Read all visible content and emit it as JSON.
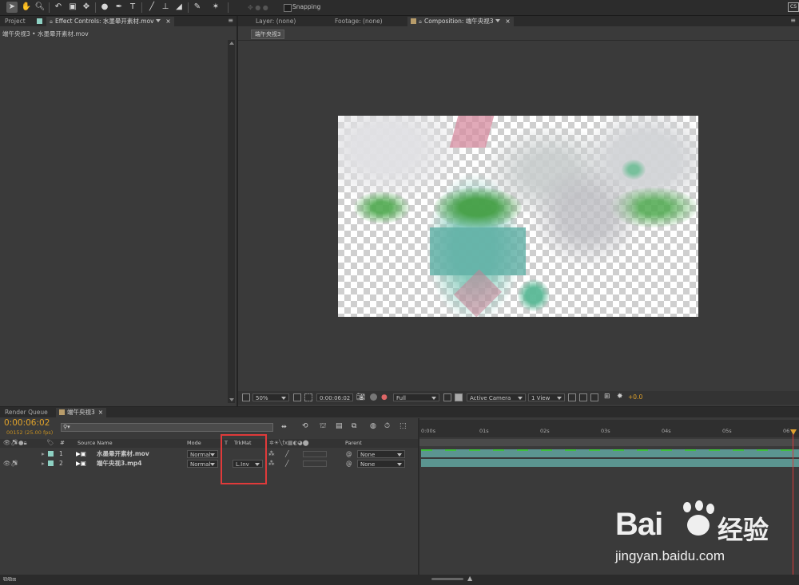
{
  "toolbar": {
    "snapping_label": "Snapping",
    "tools": [
      "selection-tool",
      "hand-tool",
      "zoom-tool",
      "rotate-tool",
      "unified-camera-tool",
      "pan-behind-tool",
      "mask-tool",
      "pen-tool",
      "type-tool",
      "brush-tool",
      "clone-stamp-tool",
      "eraser-tool",
      "roto-brush-tool",
      "puppet-pin-tool"
    ]
  },
  "left_panel": {
    "tab_project": "Project",
    "tab_effect_controls": "Effect Controls: 水墨晕开素材.mov",
    "breadcrumb": "端午央视3 • 水墨晕开素材.mov"
  },
  "viewer": {
    "tab_layer": "Layer: (none)",
    "tab_footage": "Footage: (none)",
    "tab_composition": "Composition: 端午央视3",
    "comp_chip": "端午央视3",
    "zoom": "50%",
    "timecode": "0:00:06:02",
    "resolution": "Full",
    "camera": "Active Camera",
    "view": "1 View",
    "exposure": "+0.0"
  },
  "timeline": {
    "tab_render_queue": "Render Queue",
    "tab_comp": "端午央视3",
    "current_time": "0:00:06:02",
    "frame_info": "00152 (25.00 fps)",
    "search_placeholder": "",
    "columns": {
      "num": "#",
      "source_name": "Source Name",
      "mode": "Mode",
      "t": "T",
      "trkmat": "TrkMat",
      "parent": "Parent"
    },
    "layers": [
      {
        "num": "1",
        "name": "水墨晕开素材.mov",
        "mode": "Normal",
        "trkmat": "",
        "parent": "None",
        "color": "#8ed1c3"
      },
      {
        "num": "2",
        "name": "端午央视3.mp4",
        "mode": "Normal",
        "trkmat": "L.Inv",
        "parent": "None",
        "color": "#8ed1c3"
      }
    ],
    "ruler": [
      "0:00s",
      "01s",
      "02s",
      "03s",
      "04s",
      "05s",
      "06"
    ]
  },
  "colors": {
    "accent_time": "#e2a32a",
    "highlight_box": "#e03a3a",
    "track_bar": "#5b9590",
    "playhead": "#e0a030"
  },
  "watermark": {
    "brand": "Bai",
    "brand_cn": "经验",
    "url": "jingyan.baidu.com"
  }
}
